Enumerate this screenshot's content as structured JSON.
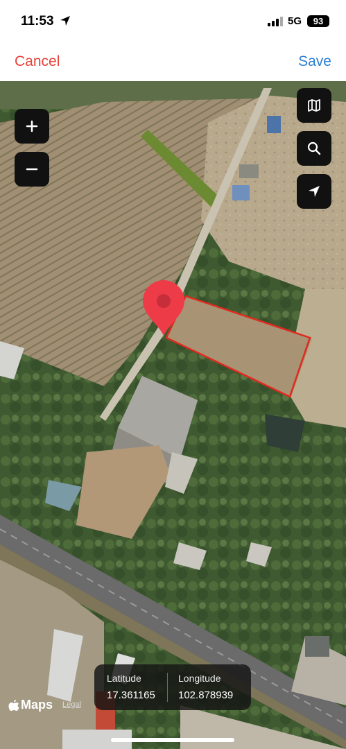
{
  "status_bar": {
    "time": "11:53",
    "network": "5G",
    "battery": "93",
    "location_icon": "location-arrow-icon",
    "signal_icon": "signal-bars-icon"
  },
  "nav": {
    "cancel_label": "Cancel",
    "save_label": "Save",
    "cancel_color": "#e5433b",
    "save_color": "#2c7fd4"
  },
  "map": {
    "controls_left": [
      {
        "icon": "plus-icon"
      },
      {
        "icon": "minus-icon"
      }
    ],
    "controls_right": [
      {
        "icon": "map-icon"
      },
      {
        "icon": "search-icon"
      },
      {
        "icon": "location-arrow-icon"
      }
    ],
    "pin_color": "#ee3b48",
    "boundary_color": "#e02a1f"
  },
  "coordinates": {
    "latitude_label": "Latitude",
    "latitude_value": "17.361165",
    "longitude_label": "Longitude",
    "longitude_value": "102.878939"
  },
  "footer": {
    "brand": "Maps",
    "legal_label": "Legal"
  }
}
